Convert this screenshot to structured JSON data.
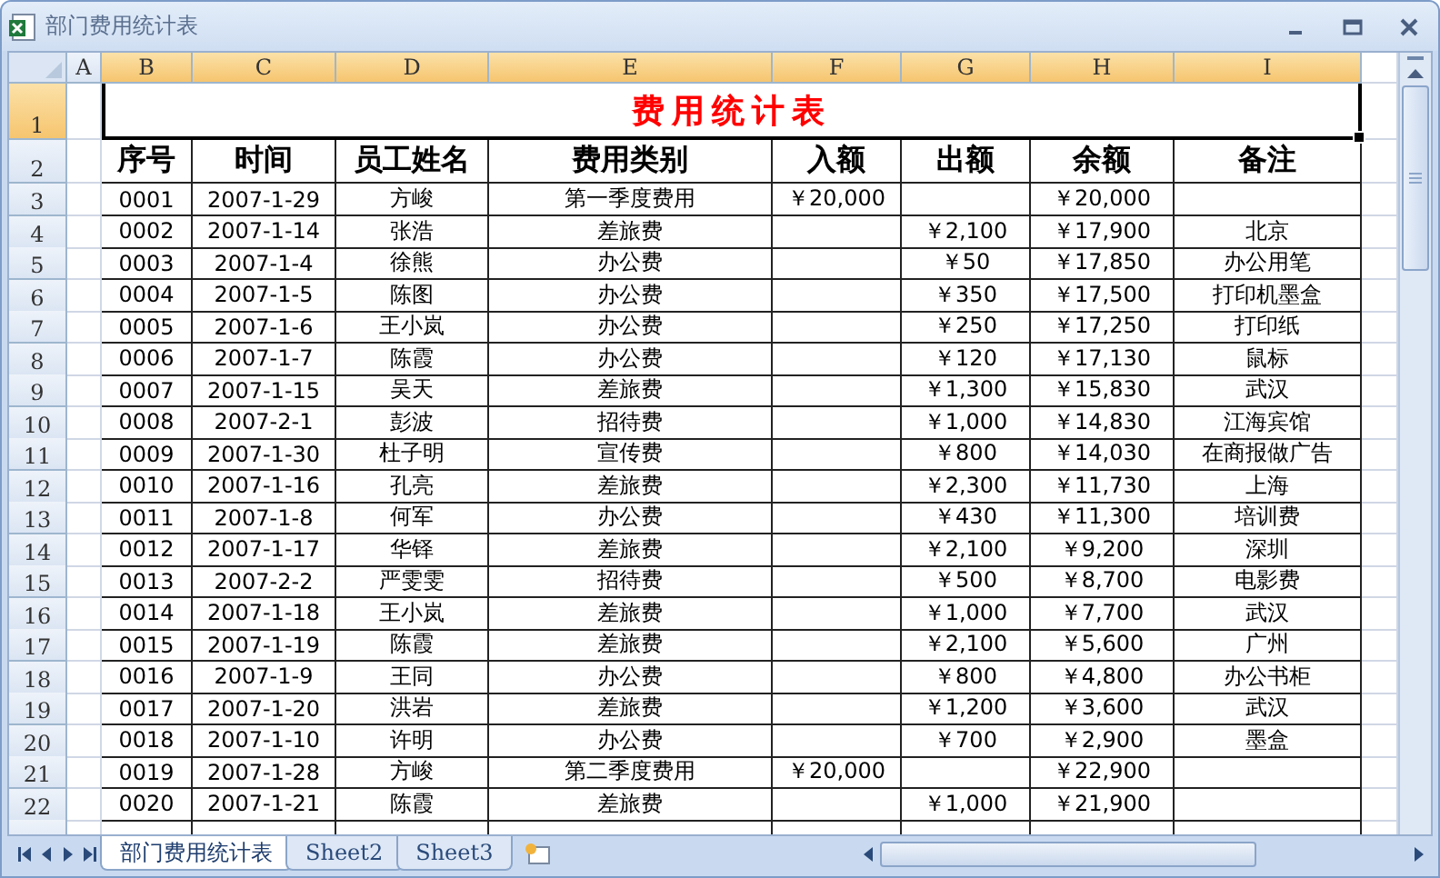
{
  "window": {
    "title": "部门费用统计表"
  },
  "columns": [
    {
      "label": "A",
      "selected": false
    },
    {
      "label": "B",
      "selected": true
    },
    {
      "label": "C",
      "selected": true
    },
    {
      "label": "D",
      "selected": true
    },
    {
      "label": "E",
      "selected": true
    },
    {
      "label": "F",
      "selected": true
    },
    {
      "label": "G",
      "selected": true
    },
    {
      "label": "H",
      "selected": true
    },
    {
      "label": "I",
      "selected": true
    }
  ],
  "title_row": {
    "row": "1",
    "title": "费用统计表",
    "selected": true
  },
  "header_row": {
    "row": "2",
    "labels": [
      "序号",
      "时间",
      "员工姓名",
      "费用类别",
      "入额",
      "出额",
      "余额",
      "备注"
    ]
  },
  "rows": [
    {
      "row": "3",
      "id": "0001",
      "date": "2007-1-29",
      "name": "方峻",
      "category": "第一季度费用",
      "income": "￥20,000",
      "balance": "￥20,000"
    },
    {
      "row": "4",
      "id": "0002",
      "date": "2007-1-14",
      "name": "张浩",
      "category": "差旅费",
      "expense": "￥2,100",
      "balance": "￥17,900",
      "note": "北京"
    },
    {
      "row": "5",
      "id": "0003",
      "date": "2007-1-4",
      "name": "徐熊",
      "category": "办公费",
      "expense": "￥50",
      "balance": "￥17,850",
      "note": "办公用笔"
    },
    {
      "row": "6",
      "id": "0004",
      "date": "2007-1-5",
      "name": "陈图",
      "category": "办公费",
      "expense": "￥350",
      "balance": "￥17,500",
      "note": "打印机墨盒"
    },
    {
      "row": "7",
      "id": "0005",
      "date": "2007-1-6",
      "name": "王小岚",
      "category": "办公费",
      "expense": "￥250",
      "balance": "￥17,250",
      "note": "打印纸"
    },
    {
      "row": "8",
      "id": "0006",
      "date": "2007-1-7",
      "name": "陈霞",
      "category": "办公费",
      "expense": "￥120",
      "balance": "￥17,130",
      "note": "鼠标"
    },
    {
      "row": "9",
      "id": "0007",
      "date": "2007-1-15",
      "name": "吴天",
      "category": "差旅费",
      "expense": "￥1,300",
      "balance": "￥15,830",
      "note": "武汉"
    },
    {
      "row": "10",
      "id": "0008",
      "date": "2007-2-1",
      "name": "彭波",
      "category": "招待费",
      "expense": "￥1,000",
      "balance": "￥14,830",
      "note": "江海宾馆"
    },
    {
      "row": "11",
      "id": "0009",
      "date": "2007-1-30",
      "name": "杜子明",
      "category": "宣传费",
      "expense": "￥800",
      "balance": "￥14,030",
      "note": "在商报做广告"
    },
    {
      "row": "12",
      "id": "0010",
      "date": "2007-1-16",
      "name": "孔亮",
      "category": "差旅费",
      "expense": "￥2,300",
      "balance": "￥11,730",
      "note": "上海"
    },
    {
      "row": "13",
      "id": "0011",
      "date": "2007-1-8",
      "name": "何军",
      "category": "办公费",
      "expense": "￥430",
      "balance": "￥11,300",
      "note": "培训费"
    },
    {
      "row": "14",
      "id": "0012",
      "date": "2007-1-17",
      "name": "华铎",
      "category": "差旅费",
      "expense": "￥2,100",
      "balance": "￥9,200",
      "note": "深圳"
    },
    {
      "row": "15",
      "id": "0013",
      "date": "2007-2-2",
      "name": "严雯雯",
      "category": "招待费",
      "expense": "￥500",
      "balance": "￥8,700",
      "note": "电影费"
    },
    {
      "row": "16",
      "id": "0014",
      "date": "2007-1-18",
      "name": "王小岚",
      "category": "差旅费",
      "expense": "￥1,000",
      "balance": "￥7,700",
      "note": "武汉"
    },
    {
      "row": "17",
      "id": "0015",
      "date": "2007-1-19",
      "name": "陈霞",
      "category": "差旅费",
      "expense": "￥2,100",
      "balance": "￥5,600",
      "note": "广州"
    },
    {
      "row": "18",
      "id": "0016",
      "date": "2007-1-9",
      "name": "王同",
      "category": "办公费",
      "expense": "￥800",
      "balance": "￥4,800",
      "note": "办公书柜"
    },
    {
      "row": "19",
      "id": "0017",
      "date": "2007-1-20",
      "name": "洪岩",
      "category": "差旅费",
      "expense": "￥1,200",
      "balance": "￥3,600",
      "note": "武汉"
    },
    {
      "row": "20",
      "id": "0018",
      "date": "2007-1-10",
      "name": "许明",
      "category": "办公费",
      "expense": "￥700",
      "balance": "￥2,900",
      "note": "墨盒"
    },
    {
      "row": "21",
      "id": "0019",
      "date": "2007-1-28",
      "name": "方峻",
      "category": "第二季度费用",
      "income": "￥20,000",
      "balance": "￥22,900"
    },
    {
      "row": "22",
      "id": "0020",
      "date": "2007-1-21",
      "name": "陈霞",
      "category": "差旅费",
      "expense": "￥1,000",
      "balance": "￥21,900"
    }
  ],
  "sheet_tabs": [
    {
      "label": "部门费用统计表",
      "selected": true
    },
    {
      "label": "Sheet2",
      "selected": false
    },
    {
      "label": "Sheet3",
      "selected": false
    }
  ]
}
